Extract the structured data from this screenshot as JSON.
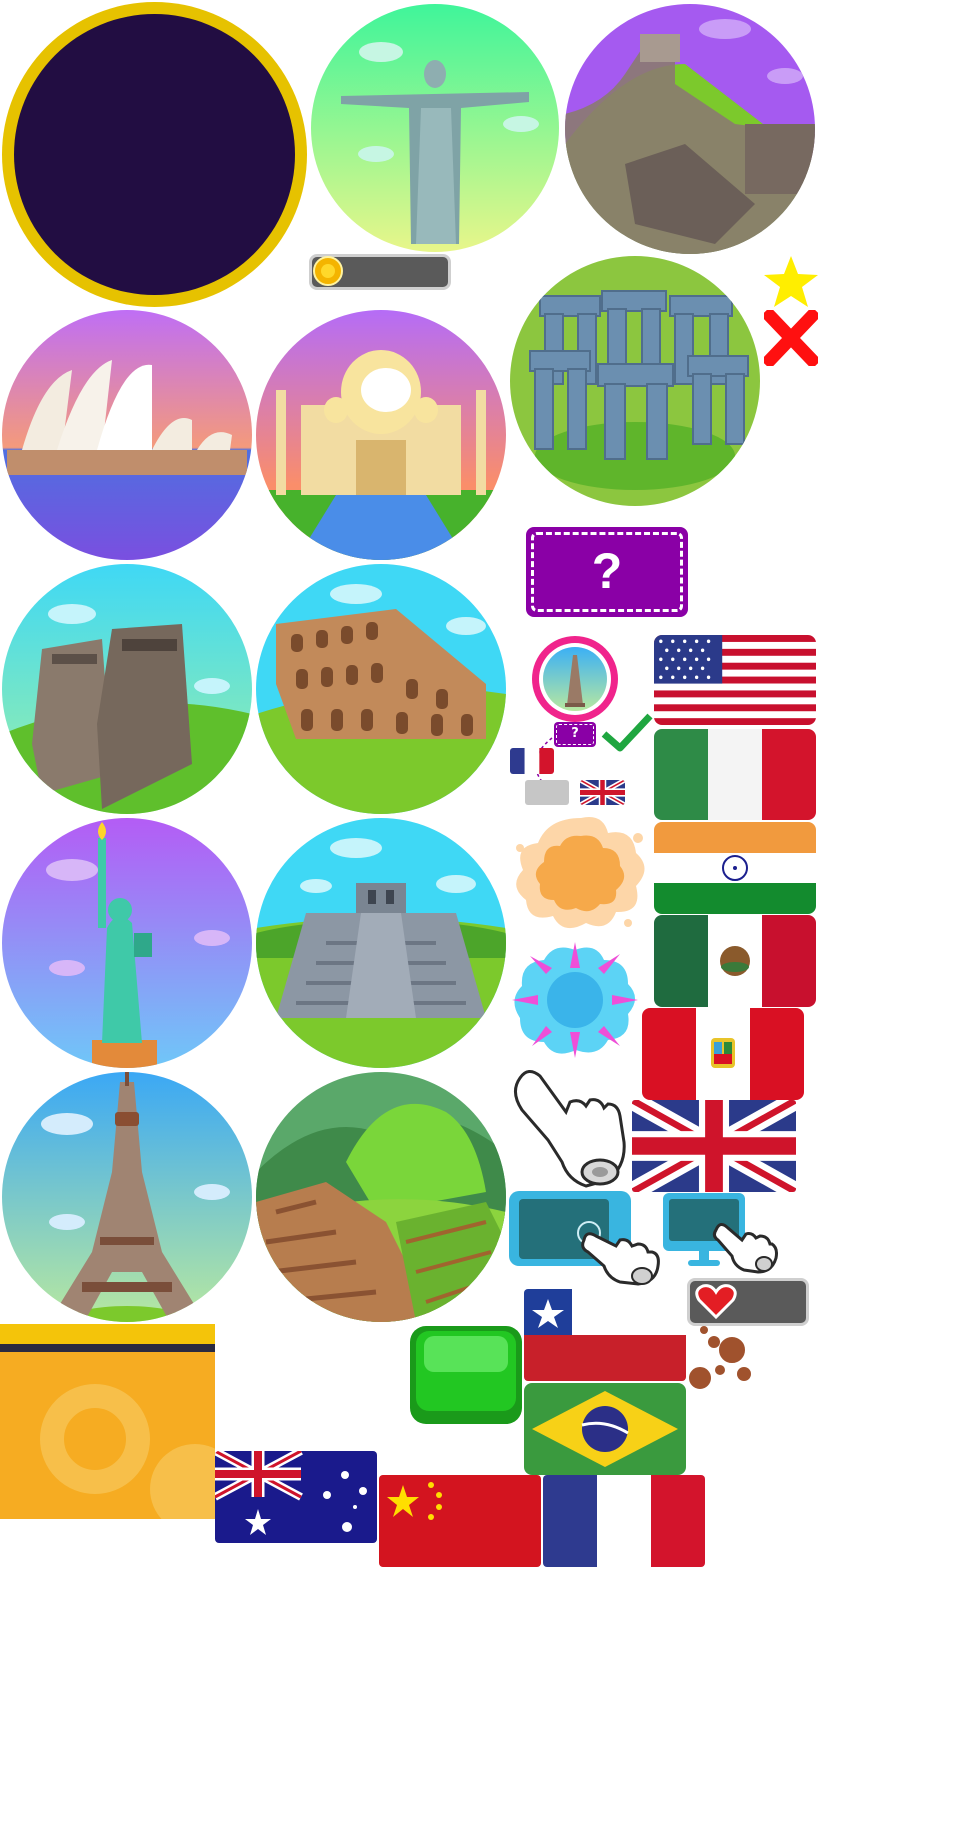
{
  "sheet": {
    "type": "sprite-sheet",
    "theme": "world-landmarks-quiz"
  },
  "landmarks": [
    {
      "id": "placeholder",
      "icon": "empty-circle-frame"
    },
    {
      "id": "christ-the-redeemer",
      "icon": "christ-the-redeemer-icon"
    },
    {
      "id": "great-wall",
      "icon": "great-wall-icon"
    },
    {
      "id": "stonehenge",
      "icon": "stonehenge-icon"
    },
    {
      "id": "sydney-opera-house",
      "icon": "sydney-opera-house-icon"
    },
    {
      "id": "taj-mahal",
      "icon": "taj-mahal-icon"
    },
    {
      "id": "moai",
      "icon": "moai-icon"
    },
    {
      "id": "colosseum",
      "icon": "colosseum-icon"
    },
    {
      "id": "statue-of-liberty",
      "icon": "statue-of-liberty-icon"
    },
    {
      "id": "chichen-itza",
      "icon": "chichen-itza-icon"
    },
    {
      "id": "eiffel-tower",
      "icon": "eiffel-tower-icon"
    },
    {
      "id": "machu-picchu",
      "icon": "machu-picchu-icon"
    }
  ],
  "ui": {
    "mystery_card_symbol": "?",
    "small_card_symbol": "?",
    "colors": {
      "frame_dark": "#220d42",
      "frame_gold": "#e6c200",
      "purple": "#8a00a6",
      "check_green": "#1fa640",
      "cross_red": "#ff1010",
      "star_yellow": "#ffee00",
      "button_green": "#22c722",
      "heart_red": "#e31e24",
      "panel_orange": "#f6ac22"
    }
  },
  "flags": [
    {
      "country": "usa"
    },
    {
      "country": "italy"
    },
    {
      "country": "india"
    },
    {
      "country": "mexico"
    },
    {
      "country": "peru"
    },
    {
      "country": "uk"
    },
    {
      "country": "chile"
    },
    {
      "country": "brazil"
    },
    {
      "country": "australia"
    },
    {
      "country": "china"
    },
    {
      "country": "france"
    }
  ]
}
